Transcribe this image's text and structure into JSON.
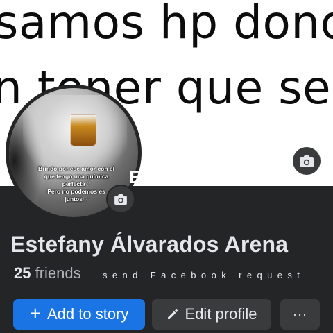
{
  "cover": {
    "line1": "samos hp dond",
    "line2": "n tener que se"
  },
  "avatar": {
    "caption_lines": [
      "Brindo por ese amor con el",
      "que tengo una química",
      "perfecta♡",
      "Pero no podemos es",
      "juntos♡"
    ],
    "stray_letter": "E"
  },
  "profile": {
    "name": "Estefany Álvarados Arena",
    "friend_count": "25",
    "friends_label": "friends",
    "request_text": "send Facebook request"
  },
  "actions": {
    "add_story_label": "Add to story",
    "edit_profile_label": "Edit profile",
    "more_label": "···"
  },
  "colors": {
    "background": "#242526",
    "primary_button": "#1b74e4",
    "secondary_button": "#3a3b3c",
    "text": "#e4e6eb",
    "muted_text": "#b0b3b8"
  },
  "icons": [
    "camera-icon",
    "plus-icon",
    "pencil-icon",
    "more-icon"
  ]
}
